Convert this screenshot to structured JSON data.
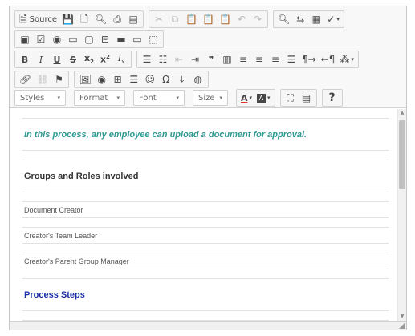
{
  "toolbar": {
    "row1": {
      "source_label": "Source"
    },
    "styles_combo": {
      "label": "Styles"
    },
    "format_combo": {
      "label": "Format"
    },
    "font_combo": {
      "label": "Font"
    },
    "size_combo": {
      "label": "Size"
    },
    "help_label": "?"
  },
  "content": {
    "intro": "In this process, any employee can upload a document for approval.",
    "groups_heading": "Groups and Roles involved",
    "roles": [
      "Document Creator",
      "Creator's Team Leader",
      "Creator's Parent Group Manager"
    ],
    "steps_heading": "Process Steps"
  },
  "colors": {
    "intro_text": "#2e9a92",
    "steps_heading": "#1b2fa8",
    "toolbar_bg": "#f8f8f8"
  }
}
